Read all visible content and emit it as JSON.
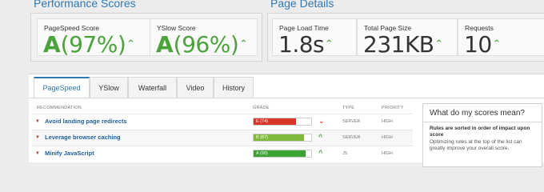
{
  "performance": {
    "title": "Performance Scores",
    "pagespeed": {
      "label": "PageSpeed Score",
      "grade": "A",
      "percent": "(97%)",
      "trend": "^"
    },
    "yslow": {
      "label": "YSlow Score",
      "grade": "A",
      "percent": "(96%)",
      "trend": "^"
    }
  },
  "details": {
    "title": "Page Details",
    "load_time": {
      "label": "Page Load Time",
      "value": "1.8s",
      "trend": "^"
    },
    "page_size": {
      "label": "Total Page Size",
      "value": "231KB",
      "trend": "^"
    },
    "requests": {
      "label": "Requests",
      "value": "10",
      "trend": "^"
    }
  },
  "tabs": [
    {
      "label": "PageSpeed",
      "active": true
    },
    {
      "label": "YSlow",
      "active": false
    },
    {
      "label": "Waterfall",
      "active": false
    },
    {
      "label": "Video",
      "active": false
    },
    {
      "label": "History",
      "active": false
    }
  ],
  "table": {
    "headers": {
      "recommendation": "RECOMMENDATION",
      "grade": "GRADE",
      "type": "TYPE",
      "priority": "PRIORITY"
    },
    "rows": [
      {
        "name": "Avoid landing page redirects",
        "grade_text": "E (74)",
        "grade_fraction": 0.74,
        "grade_color": "#d9362b",
        "trend": "down",
        "type": "SERVER",
        "priority": "HIGH"
      },
      {
        "name": "Leverage browser caching",
        "grade_text": "B (87)",
        "grade_fraction": 0.87,
        "grade_color": "#7fb93a",
        "trend": "up",
        "type": "SERVER",
        "priority": "HIGH"
      },
      {
        "name": "Minify JavaScript",
        "grade_text": "A (90)",
        "grade_fraction": 0.9,
        "grade_color": "#3aa331",
        "trend": "up",
        "type": "JS",
        "priority": "HIGH"
      }
    ]
  },
  "sidebar": {
    "title": "What do my scores mean?",
    "bold_text": "Rules are sorted in order of impact upon score",
    "text": "Optimizing rules at the top of the list can greatly improve your overall score."
  },
  "colors": {
    "accent": "#2d79b5",
    "good": "#4aa23a",
    "bad": "#d9362b"
  }
}
